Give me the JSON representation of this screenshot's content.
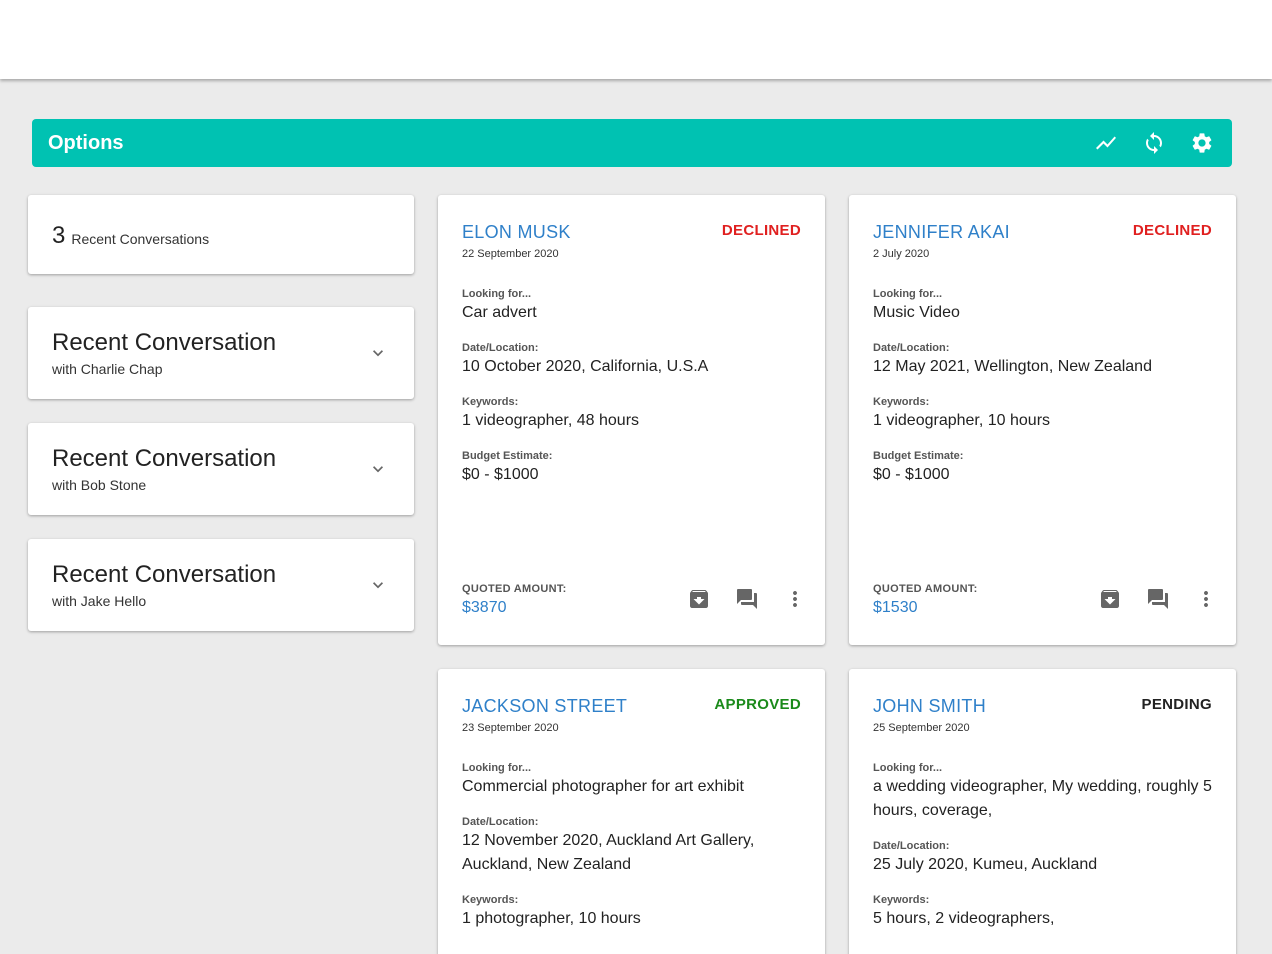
{
  "options": {
    "title": "Options",
    "actions": [
      "trending-icon",
      "refresh-icon",
      "settings-icon"
    ]
  },
  "summary": {
    "count": "3",
    "label": "Recent Conversations"
  },
  "conversations": [
    {
      "title": "Recent Conversation",
      "with": "with Charlie Chap"
    },
    {
      "title": "Recent Conversation",
      "with": "with Bob Stone"
    },
    {
      "title": "Recent Conversation",
      "with": "with Jake Hello"
    }
  ],
  "colors": {
    "accent": "#00c2b2",
    "link": "#2f80c9",
    "declined": "#e02020",
    "approved": "#1a8a1a",
    "pending": "#222222"
  },
  "field_labels": {
    "looking_for": "Looking for...",
    "date_location": "Date/Location:",
    "keywords": "Keywords:",
    "budget": "Budget Estimate:",
    "quoted": "QUOTED AMOUNT:"
  },
  "cards": [
    {
      "name": "ELON MUSK",
      "date": "22 September 2020",
      "status": "DECLINED",
      "looking_for": "Car advert",
      "date_location": "10 October 2020, California, U.S.A",
      "keywords": "1 videographer, 48 hours",
      "budget": "$0 - $1000",
      "quoted": "$3870"
    },
    {
      "name": "JENNIFER AKAI",
      "date": "2 July 2020",
      "status": "DECLINED",
      "looking_for": "Music Video",
      "date_location": "12 May 2021, Wellington, New Zealand",
      "keywords": "1 videographer, 10 hours",
      "budget": "$0 - $1000",
      "quoted": "$1530"
    },
    {
      "name": "JACKSON STREET",
      "date": "23 September 2020",
      "status": "APPROVED",
      "looking_for": "Commercial photographer for art exhibit",
      "date_location": "12 November 2020, Auckland Art Gallery, Auckland, New Zealand",
      "keywords": "1 photographer, 10 hours"
    },
    {
      "name": "JOHN SMITH",
      "date": "25 September 2020",
      "status": "PENDING",
      "looking_for": "a wedding videographer, My wedding, roughly 5 hours, coverage,",
      "date_location": "25 July 2020, Kumeu, Auckland",
      "keywords": "5 hours, 2 videographers,"
    }
  ]
}
